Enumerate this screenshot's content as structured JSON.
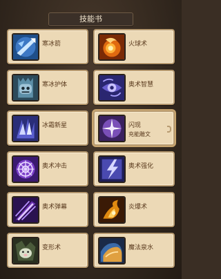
{
  "panel": {
    "title": "技能书"
  },
  "skills": [
    {
      "name": "寒冰箭",
      "icon": "ice-arrow-icon",
      "color": "#3d78c4"
    },
    {
      "name": "火球术",
      "icon": "fireball-icon",
      "color": "#e06a10"
    },
    {
      "name": "寒冰护体",
      "icon": "ice-armor-icon",
      "color": "#5d8fa8"
    },
    {
      "name": "奥术智慧",
      "icon": "arcane-intellect-icon",
      "color": "#6a5fcf"
    },
    {
      "name": "冰霜新星",
      "icon": "frost-nova-icon",
      "color": "#5a5fcf"
    },
    {
      "name": "闪现",
      "sub": "充能雕文",
      "icon": "blink-icon",
      "color": "#7a4fb8"
    },
    {
      "name": "奥术冲击",
      "icon": "arcane-explosion-icon",
      "color": "#7a3fc8"
    },
    {
      "name": "奥术强化",
      "icon": "arcane-power-icon",
      "color": "#4a4ab0"
    },
    {
      "name": "奥术弹幕",
      "icon": "arcane-barrage-icon",
      "color": "#6a2fb0"
    },
    {
      "name": "炎爆术",
      "icon": "pyroblast-icon",
      "color": "#e08a10"
    },
    {
      "name": "变形术",
      "icon": "polymorph-icon",
      "color": "#4a5a3a"
    },
    {
      "name": "魔法泉水",
      "icon": "conjure-water-icon",
      "color": "#3a6aa8"
    }
  ]
}
